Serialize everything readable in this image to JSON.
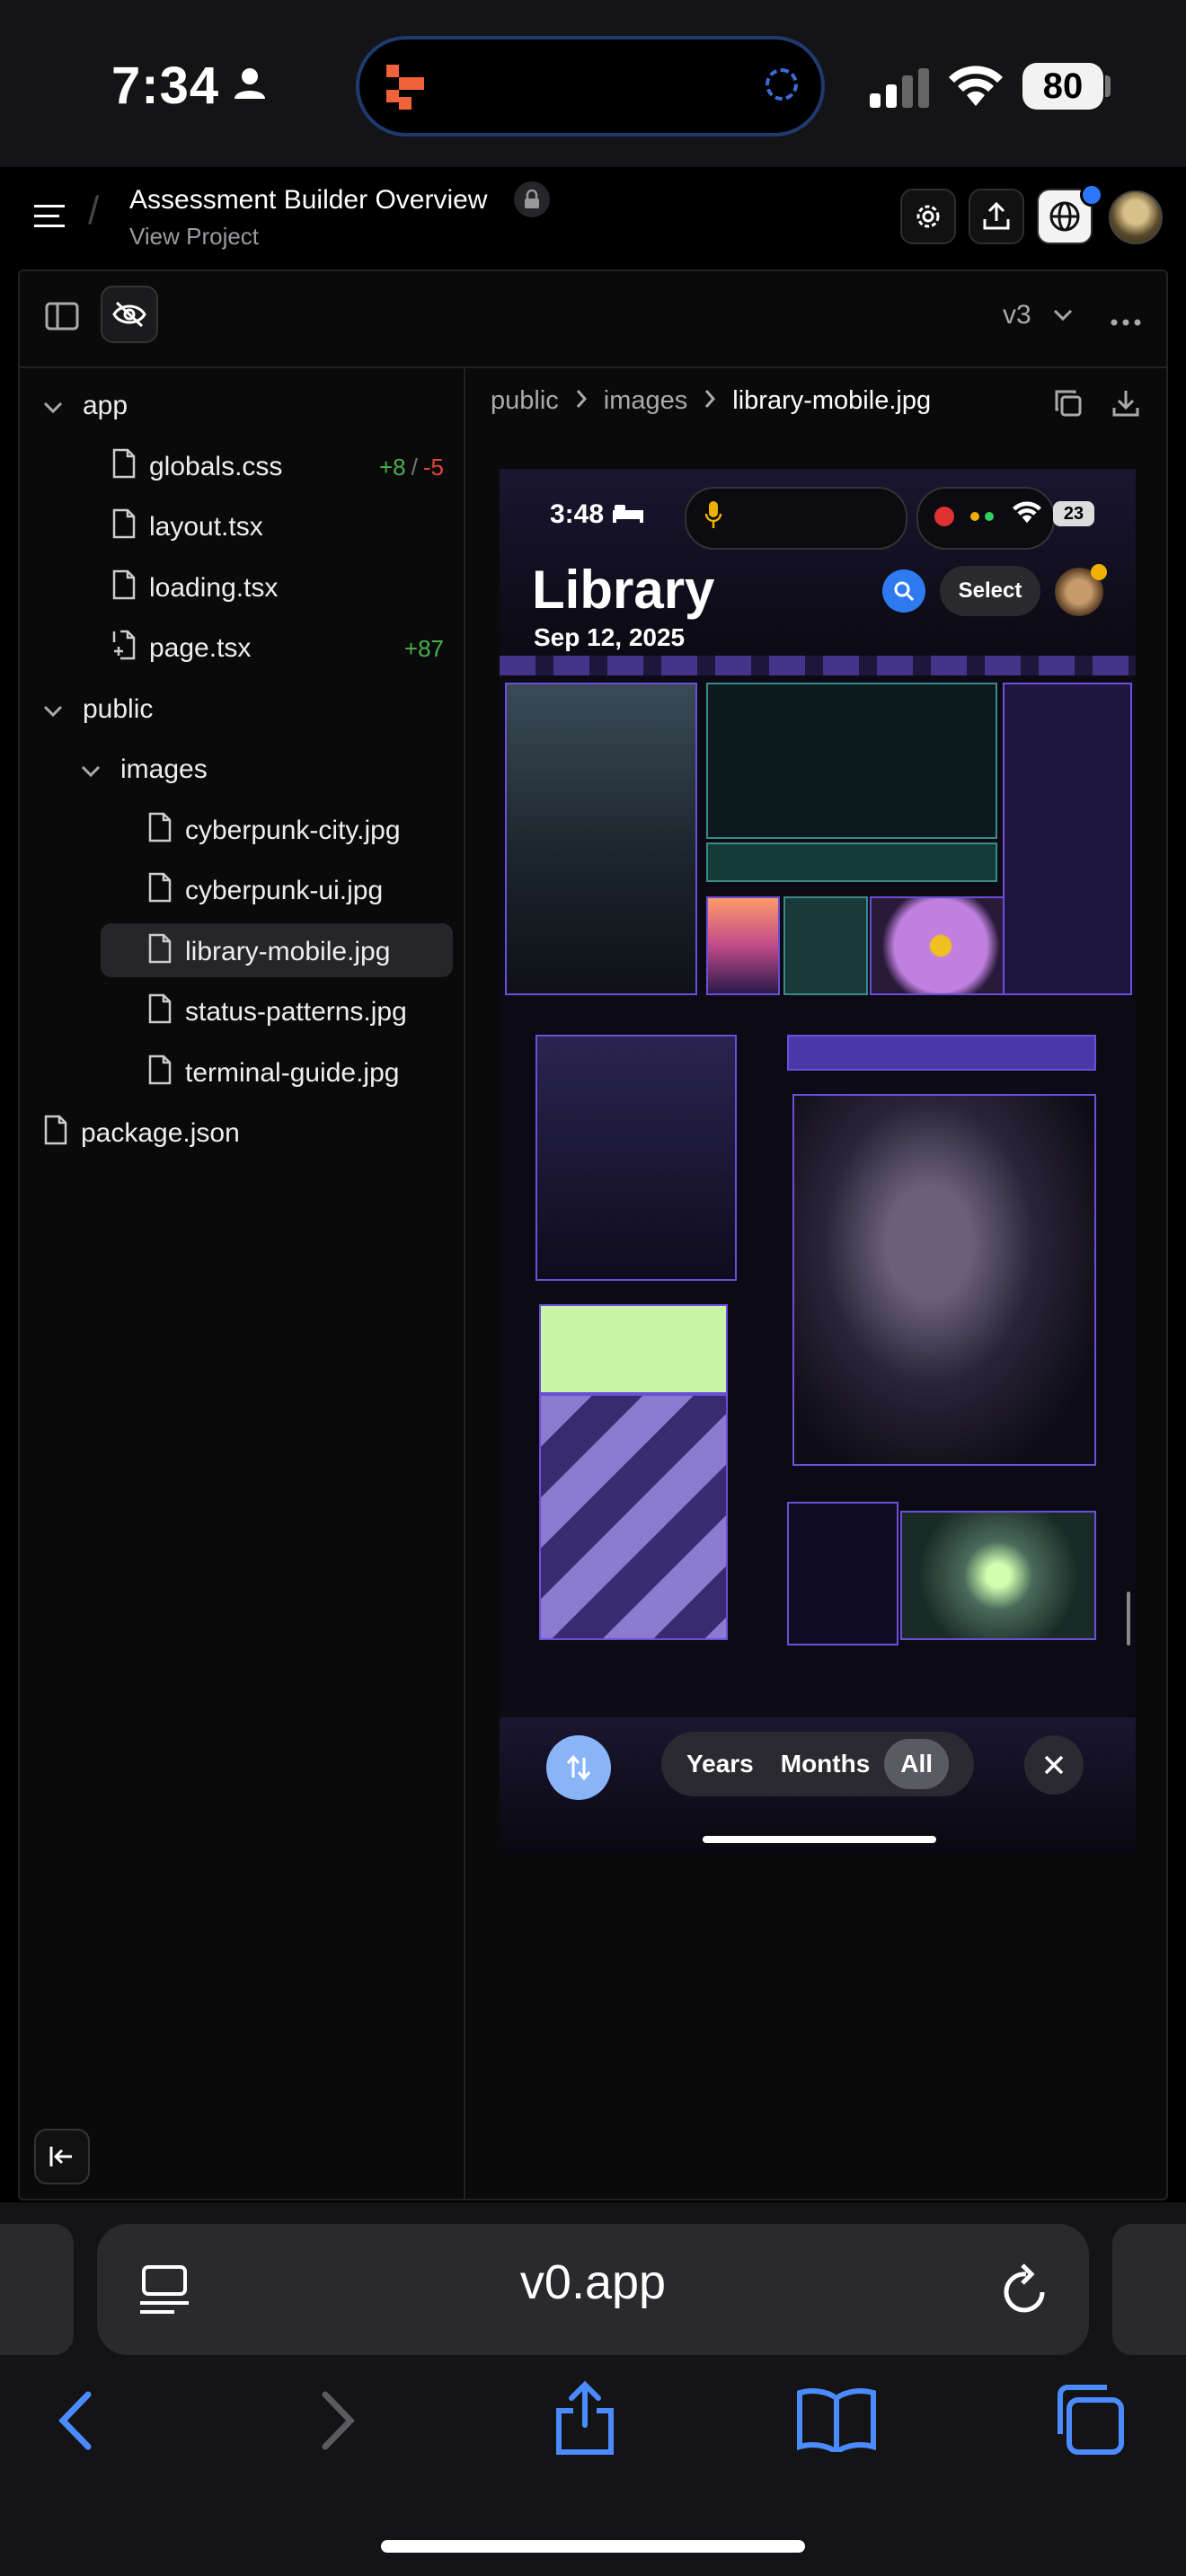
{
  "status_bar": {
    "time": "7:34",
    "battery": "80"
  },
  "header": {
    "project_title": "Assessment Builder Overview",
    "project_subtitle": "View Project"
  },
  "toolbar": {
    "version": "v3"
  },
  "file_tree": [
    {
      "label": "app",
      "type": "folder",
      "depth": 0
    },
    {
      "label": "globals.css",
      "type": "file",
      "depth": 1,
      "added": "+8",
      "sep": "/",
      "removed": "-5"
    },
    {
      "label": "layout.tsx",
      "type": "file",
      "depth": 1
    },
    {
      "label": "loading.tsx",
      "type": "file",
      "depth": 1
    },
    {
      "label": "page.tsx",
      "type": "file-new",
      "depth": 1,
      "added": "+87"
    },
    {
      "label": "public",
      "type": "folder",
      "depth": 0
    },
    {
      "label": "images",
      "type": "folder",
      "depth": 1
    },
    {
      "label": "cyberpunk-city.jpg",
      "type": "file",
      "depth": 2
    },
    {
      "label": "cyberpunk-ui.jpg",
      "type": "file",
      "depth": 2
    },
    {
      "label": "library-mobile.jpg",
      "type": "file",
      "depth": 2,
      "selected": true
    },
    {
      "label": "status-patterns.jpg",
      "type": "file",
      "depth": 2
    },
    {
      "label": "terminal-guide.jpg",
      "type": "file",
      "depth": 2
    },
    {
      "label": "package.json",
      "type": "file",
      "depth": 0
    }
  ],
  "breadcrumb": [
    "public",
    "images",
    "library-mobile.jpg"
  ],
  "preview": {
    "time": "3:48",
    "battery": "23",
    "title": "Library",
    "date": "Sep 12, 2025",
    "select_label": "Select",
    "segments": [
      "Years",
      "Months",
      "All"
    ],
    "active_segment": "All"
  },
  "safari": {
    "url": "v0.app"
  },
  "colors": {
    "accent_purple": "#6b4fd8",
    "add_green": "#4caf50",
    "del_red": "#e0463a",
    "link_blue": "#2b77ff"
  }
}
